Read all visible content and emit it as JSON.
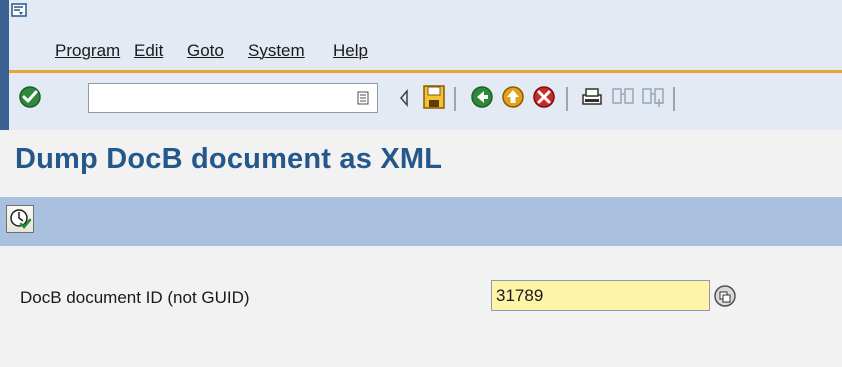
{
  "menu": {
    "items": [
      {
        "label": "Program"
      },
      {
        "label": "Edit"
      },
      {
        "label": "Goto"
      },
      {
        "label": "System"
      },
      {
        "label": "Help"
      }
    ]
  },
  "toolbar": {
    "command_field_value": "",
    "icons": [
      "enter-check-icon",
      "command-history-icon",
      "collapse-toolbar-icon",
      "save-icon",
      "back-icon",
      "exit-icon",
      "cancel-icon",
      "print-icon",
      "find-icon",
      "find-next-icon"
    ]
  },
  "page": {
    "title": "Dump DocB document as XML"
  },
  "application_toolbar": {
    "icons": [
      "execute-icon"
    ]
  },
  "form": {
    "doc_id": {
      "label": "DocB document ID (not GUID)",
      "value": "31789"
    }
  },
  "colors": {
    "title": "#24588a",
    "header_bg": "#e4eaf3",
    "app_toolbar_bg": "#a9c1de",
    "accent_line": "#e8a33b",
    "required_field_bg": "#fff3a8"
  }
}
